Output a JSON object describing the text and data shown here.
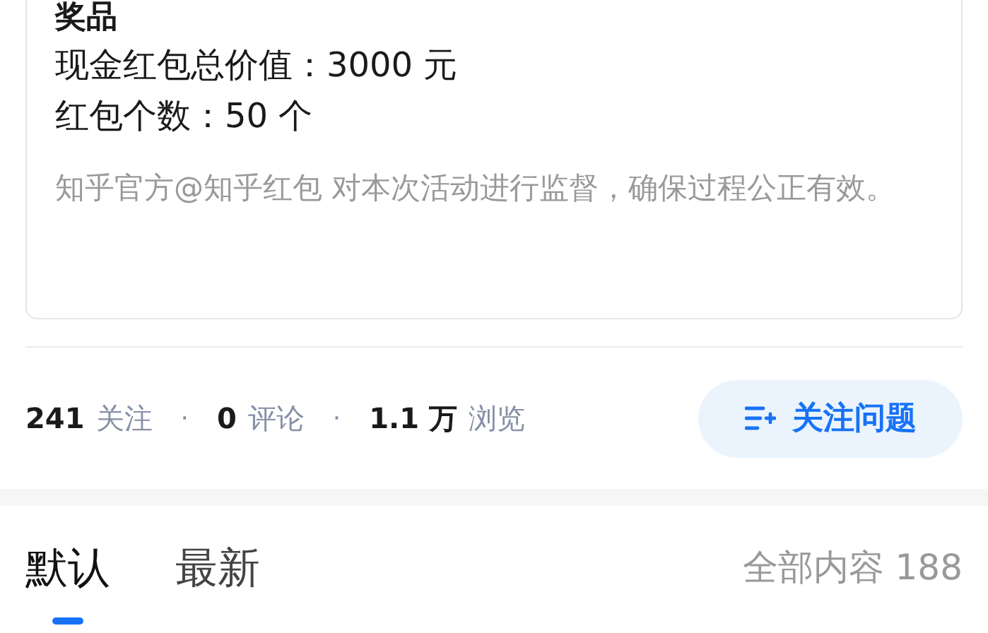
{
  "prize_card": {
    "title": "奖品",
    "lines": [
      "现金红包总价值：3000 元",
      "红包个数：50 个"
    ],
    "note": "知乎官方@知乎红包 对本次活动进行监督，确保过程公正有效。"
  },
  "stats": [
    {
      "value": "241",
      "label": "关注"
    },
    {
      "value": "0",
      "label": "评论"
    },
    {
      "value": "1.1 万",
      "label": "浏览"
    }
  ],
  "separator": "·",
  "follow_button": {
    "label": "关注问题"
  },
  "tabs": [
    {
      "label": "默认",
      "selected": true
    },
    {
      "label": "最新",
      "selected": false
    }
  ],
  "content_count": "全部内容 188"
}
